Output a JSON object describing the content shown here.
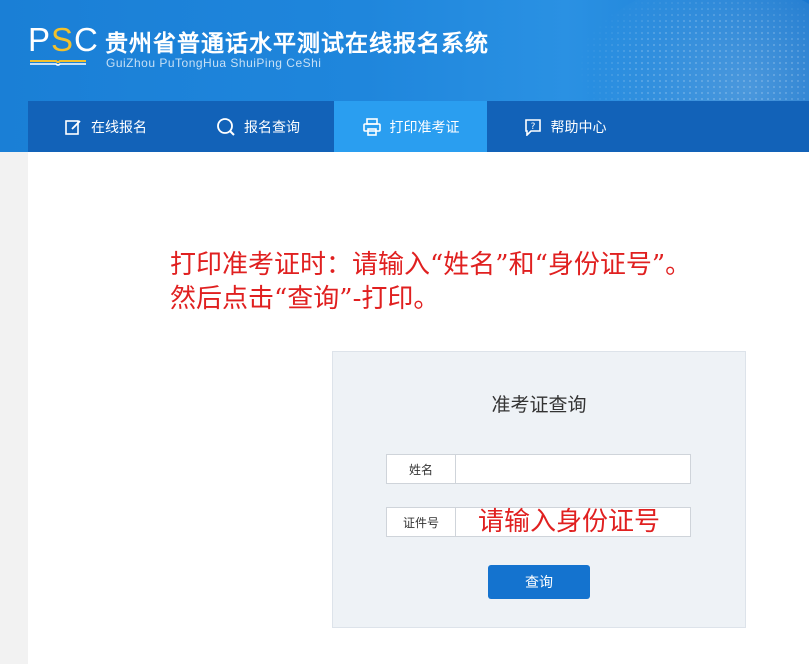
{
  "header": {
    "logo_prefix": "P",
    "logo_accent": "S",
    "logo_suffix": "C",
    "title": "贵州省普通话水平测试在线报名系统",
    "subtitle": "GuiZhou PuTongHua ShuiPing CeShi"
  },
  "nav": {
    "items": [
      {
        "label": "在线报名",
        "icon": "edit-icon"
      },
      {
        "label": "报名查询",
        "icon": "search-icon"
      },
      {
        "label": "打印准考证",
        "icon": "printer-icon",
        "active": true
      },
      {
        "label": "帮助中心",
        "icon": "help-icon"
      }
    ]
  },
  "notice": {
    "line1": "打印准考证时：请输入“姓名”和“身份证号”。",
    "line2": "然后点击“查询”-打印。"
  },
  "form": {
    "title": "准考证查询",
    "name_label": "姓名",
    "name_value": "",
    "id_label": "证件号",
    "id_value": "",
    "id_hint": "请输入身份证号",
    "query_button": "查询"
  },
  "colors": {
    "header_blue": "#1f86dc",
    "nav_blue": "#1262b8",
    "nav_active": "#2a9ef0",
    "annotation_red": "#e02020",
    "button_blue": "#1473cf"
  }
}
